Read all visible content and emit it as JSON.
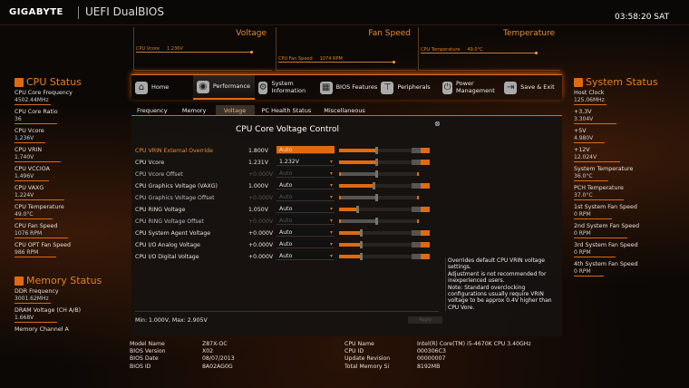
{
  "header": {
    "brand": "GIGABYTE",
    "title": "UEFI DualBIOS",
    "clock": "03:58:20 SAT"
  },
  "graphs": [
    {
      "title": "Voltage",
      "label": "CPU Vcore",
      "value": "1.236V"
    },
    {
      "title": "Fan Speed",
      "label": "CPU Fan Speed",
      "value": "1074 RPM"
    },
    {
      "title": "Temperature",
      "label": "CPU Temperature",
      "value": "49.0°C"
    }
  ],
  "nav": [
    {
      "label": "Home",
      "icon": "home-icon"
    },
    {
      "label": "Performance",
      "icon": "performance-icon",
      "active": true
    },
    {
      "label": "System Information",
      "icon": "gear-icon"
    },
    {
      "label": "BIOS Features",
      "icon": "bios-features-icon"
    },
    {
      "label": "Peripherals",
      "icon": "peripherals-icon"
    },
    {
      "label": "Power Management",
      "icon": "power-icon"
    },
    {
      "label": "Save & Exit",
      "icon": "exit-icon"
    }
  ],
  "tabs": [
    {
      "label": "Frequency"
    },
    {
      "label": "Memory"
    },
    {
      "label": "Voltage",
      "active": true
    },
    {
      "label": "PC Health Status"
    },
    {
      "label": "Miscellaneous"
    }
  ],
  "panel": {
    "title": "CPU Core Voltage Control",
    "close_icon": "close-icon",
    "rows": [
      {
        "label": "CPU VRIN External Override",
        "value": "1.800V",
        "setting": "Auto",
        "slider": 0.45,
        "state": "highlight",
        "toggle": true
      },
      {
        "label": "CPU Vcore",
        "value": "1.231V",
        "setting": "1.232V",
        "slider": 0.45,
        "toggle": true
      },
      {
        "label": "CPU Vcore Offset",
        "value": "+0.000V",
        "setting": "Auto",
        "slider": 0.45,
        "state": "disabled",
        "toggle": false
      },
      {
        "label": "CPU Graphics Voltage (VAXG)",
        "value": "1.000V",
        "setting": "Auto",
        "slider": 0.42,
        "toggle": true
      },
      {
        "label": "CPU Graphics Voltage Offset",
        "value": "+0.000V",
        "setting": "Auto",
        "slider": 0.45,
        "state": "disabled",
        "toggle": false
      },
      {
        "label": "CPU RING Voltage",
        "value": "1.050V",
        "setting": "Auto",
        "slider": 0.2,
        "toggle": true
      },
      {
        "label": "CPU RING Voltage Offset",
        "value": "+0.000V",
        "setting": "Auto",
        "slider": 0.45,
        "state": "disabled",
        "toggle": false
      },
      {
        "label": "CPU System Agent Voltage",
        "value": "+0.000V",
        "setting": "Auto",
        "slider": 0.25,
        "toggle": true
      },
      {
        "label": "CPU I/O Analog Voltage",
        "value": "+0.000V",
        "setting": "Auto",
        "slider": 0.25,
        "toggle": true
      },
      {
        "label": "CPU I/O Digital Voltage",
        "value": "+0.000V",
        "setting": "Auto",
        "slider": 0.25,
        "toggle": true
      }
    ],
    "range": "Min: 1.000V, Max: 2.905V",
    "apply": "Apply",
    "help": "Overrides default CPU VRIN voltage settings.\nAdjustment is not recommended for inexperienced users.\nNote: Standard overclocking configurations usually require VRIN voltage to be approx 0.4V higher than CPU Vore."
  },
  "cpu_status": {
    "title": "CPU Status",
    "items": [
      {
        "label": "CPU Core Frequency",
        "value": "4502.44MHz"
      },
      {
        "label": "CPU Core Ratio",
        "value": "36"
      },
      {
        "label": "CPU Vcore",
        "value": "1.236V"
      },
      {
        "label": "CPU VRIN",
        "value": "1.740V"
      },
      {
        "label": "CPU VCCIOA",
        "value": "1.496V"
      },
      {
        "label": "CPU VAXG",
        "value": "1.224V"
      },
      {
        "label": "CPU Temperature",
        "value": "49.0°C"
      },
      {
        "label": "CPU Fan Speed",
        "value": "1076 RPM"
      },
      {
        "label": "CPU OPT Fan Speed",
        "value": "986 RPM"
      }
    ]
  },
  "memory_status": {
    "title": "Memory Status",
    "items": [
      {
        "label": "DDR Frequency",
        "value": "3001.62MHz"
      },
      {
        "label": "DRAM Voltage    (CH A/B)",
        "value": "1.668V"
      },
      {
        "label": "Memory Channel A",
        "value": ""
      }
    ]
  },
  "system_status": {
    "title": "System Status",
    "items": [
      {
        "label": "Host Clock",
        "value": "125.06MHz"
      },
      {
        "label": "+3.3V",
        "value": "3.304V"
      },
      {
        "label": "+5V",
        "value": "4.980V"
      },
      {
        "label": "+12V",
        "value": "12.024V"
      },
      {
        "label": "System Temperature",
        "value": "36.0°C"
      },
      {
        "label": "PCH Temperature",
        "value": "37.0°C"
      },
      {
        "label": "1st System Fan Speed",
        "value": "0 RPM"
      },
      {
        "label": "2nd System Fan Speed",
        "value": "0 RPM"
      },
      {
        "label": "3rd System Fan Speed",
        "value": "0 RPM"
      },
      {
        "label": "4th System Fan Speed",
        "value": "0 RPM"
      }
    ]
  },
  "footer": {
    "left": [
      [
        "Model Name",
        "Z87X-OC"
      ],
      [
        "BIOS Version",
        "X02"
      ],
      [
        "BIOS Date",
        "08/07/2013"
      ],
      [
        "BIOS ID",
        "8A02AG0G"
      ]
    ],
    "right": [
      [
        "CPU Name",
        "Intel(R) Core(TM) i5-4670K CPU  3.40GHz"
      ],
      [
        "CPU ID",
        "000306C3"
      ],
      [
        "Update Revision",
        "00000007"
      ],
      [
        "Total Memory Si",
        "8192MB"
      ]
    ]
  },
  "colors": {
    "accent": "#e06a10",
    "background": "#0b0806"
  }
}
